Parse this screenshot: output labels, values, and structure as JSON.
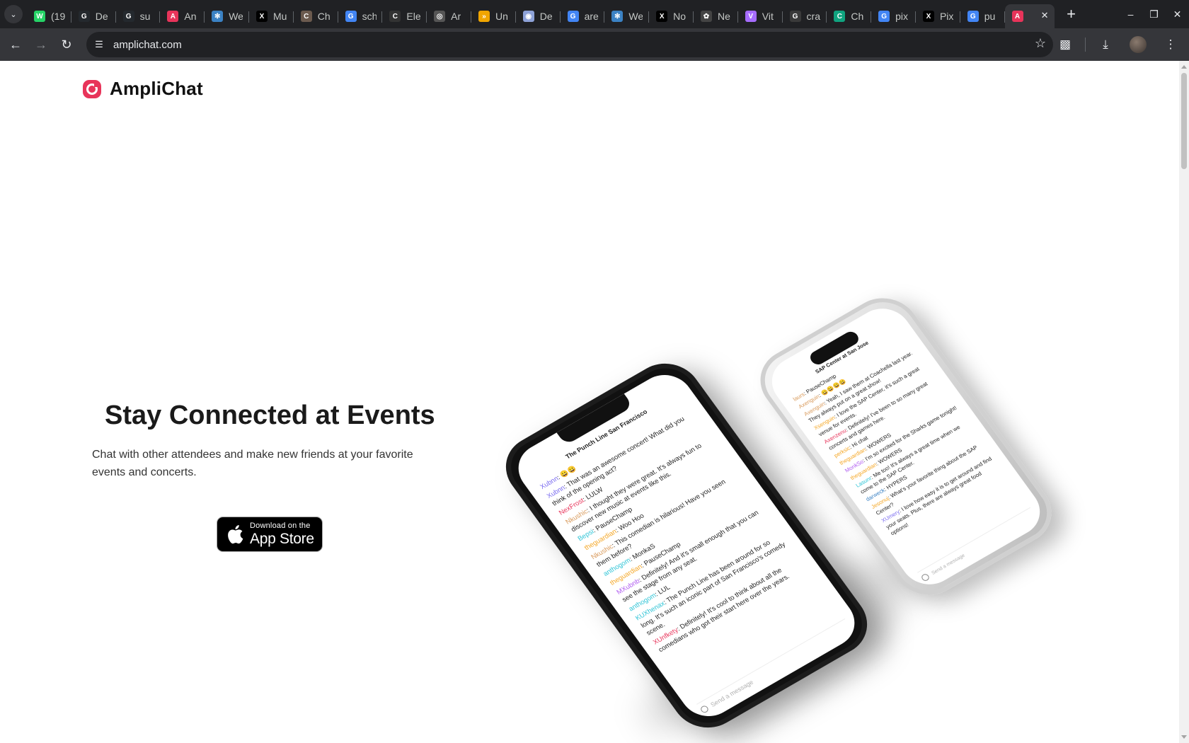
{
  "browser": {
    "tabs": [
      {
        "title": "(19",
        "icon": "whatsapp-icon",
        "color": "#25d366",
        "glyph": "W"
      },
      {
        "title": "De",
        "icon": "github-icon",
        "color": "#24292e",
        "glyph": "G"
      },
      {
        "title": "su",
        "icon": "github-icon",
        "color": "#24292e",
        "glyph": "G"
      },
      {
        "title": "An",
        "icon": "amplichat-icon",
        "color": "#e8345a",
        "glyph": "A"
      },
      {
        "title": "We",
        "icon": "react-icon",
        "color": "#3b82c4",
        "glyph": "✻"
      },
      {
        "title": "Mu",
        "icon": "x-icon",
        "color": "#000000",
        "glyph": "X"
      },
      {
        "title": "Ch",
        "icon": "profile-icon",
        "color": "#6b5a4e",
        "glyph": "C"
      },
      {
        "title": "sch",
        "icon": "google-icon",
        "color": "#4285f4",
        "glyph": "G"
      },
      {
        "title": "Ele",
        "icon": "codesandbox-icon",
        "color": "#333333",
        "glyph": "C"
      },
      {
        "title": "Ar",
        "icon": "globe-icon",
        "color": "#555555",
        "glyph": "◎"
      },
      {
        "title": "Un",
        "icon": "unsloth-icon",
        "color": "#f0a500",
        "glyph": "»"
      },
      {
        "title": "De",
        "icon": "deepseek-icon",
        "color": "#8ea2d8",
        "glyph": "◉"
      },
      {
        "title": "are",
        "icon": "google-icon",
        "color": "#4285f4",
        "glyph": "G"
      },
      {
        "title": "We",
        "icon": "react-icon",
        "color": "#3b82c4",
        "glyph": "✻"
      },
      {
        "title": "No",
        "icon": "x-icon",
        "color": "#000000",
        "glyph": "X"
      },
      {
        "title": "Ne",
        "icon": "openai-icon",
        "color": "#444444",
        "glyph": "✿"
      },
      {
        "title": "Vit",
        "icon": "vite-icon",
        "color": "#a66cff",
        "glyph": "V"
      },
      {
        "title": "cra",
        "icon": "github-icon",
        "color": "#3a3a3a",
        "glyph": "G"
      },
      {
        "title": "Ch",
        "icon": "chatgpt-icon",
        "color": "#10a37f",
        "glyph": "C"
      },
      {
        "title": "pix",
        "icon": "google-icon",
        "color": "#4285f4",
        "glyph": "G"
      },
      {
        "title": "Pix",
        "icon": "x-icon",
        "color": "#000000",
        "glyph": "X"
      },
      {
        "title": "pu",
        "icon": "google-icon",
        "color": "#4285f4",
        "glyph": "G"
      },
      {
        "title": "",
        "icon": "amplichat-icon",
        "color": "#e8345a",
        "glyph": "A",
        "active": true
      }
    ],
    "url": "amplichat.com"
  },
  "site": {
    "brand": "AmpliChat",
    "brand_color": "#e8345a",
    "hero_title": "Stay Connected at Events",
    "hero_subtitle": "Chat with other attendees and make new friends at your favorite events and concerts.",
    "appstore_small": "Download on the",
    "appstore_big": "App Store"
  },
  "phone_front": {
    "venue": "The Punch Line San Francisco",
    "messages": [
      {
        "user": "Xubnn",
        "color": "#7b6cf0",
        "text": "😀😀"
      },
      {
        "user": "Xubnn",
        "color": "#7b6cf0",
        "text": "That was an awesome concert! What did you think of the opening act?"
      },
      {
        "user": "NexFrost",
        "color": "#e8345a",
        "text": "LULW"
      },
      {
        "user": "Nkushic",
        "color": "#d99a5b",
        "text": "I thought they were great. It's always fun to discover new music at events like this."
      },
      {
        "user": "Bepsi",
        "color": "#2ec4d6",
        "text": "PauseChamp"
      },
      {
        "user": "theguardian",
        "color": "#f5a623",
        "text": "Woo Hoo"
      },
      {
        "user": "Nkushic",
        "color": "#d99a5b",
        "text": "This comedian is hilarious! Have you seen them before?"
      },
      {
        "user": "anthogom",
        "color": "#2ec4d6",
        "text": "MonkaS"
      },
      {
        "user": "theguardian",
        "color": "#f5a623",
        "text": "PauseChamp"
      },
      {
        "user": "MXubnb",
        "color": "#b05cf0",
        "text": "Definitely! And it's small enough that you can see the stage from any seat."
      },
      {
        "user": "anthogom",
        "color": "#2ec4d6",
        "text": "LUL"
      },
      {
        "user": "KUXhenax",
        "color": "#2ec4d6",
        "text": "The Punch Line has been around for so long. It's such an iconic part of San Francisco's comedy scene."
      },
      {
        "user": "XUnfkety",
        "color": "#e8345a",
        "text": "Definitely! It's cool to think about all the comedians who got their start here over the years."
      }
    ],
    "placeholder": "Send a message"
  },
  "phone_back": {
    "venue": "SAP Center at San Jose",
    "messages": [
      {
        "user": "laurs",
        "color": "#d99a5b",
        "text": "PauseChamp"
      },
      {
        "user": "Axenguin",
        "color": "#d99a5b",
        "text": "😀😀😀😀"
      },
      {
        "user": "Axenguin",
        "color": "#d99a5b",
        "text": "Yeah, I saw them at Coachella last year. They always put on a great show!"
      },
      {
        "user": "Xsenguin",
        "color": "#f5a623",
        "text": "I love the SAP Center, it's such a great venue for events."
      },
      {
        "user": "Axenzenu",
        "color": "#e8345a",
        "text": "Definitely! I've been to so many great concerts and games here."
      },
      {
        "user": "perksic",
        "color": "#f5a623",
        "text": "Hi chat"
      },
      {
        "user": "theguardian",
        "color": "#f5a623",
        "text": "WOWERS"
      },
      {
        "user": "MonkSo",
        "color": "#b05cf0",
        "text": "I'm so excited for the Sharks game tonight!"
      },
      {
        "user": "theguardian",
        "color": "#f5a623",
        "text": "WOWERS"
      },
      {
        "user": "Lasunr",
        "color": "#2ec4d6",
        "text": "Me too! It's always a great time when we come to the SAP Center."
      },
      {
        "user": "darweck",
        "color": "#3b82c4",
        "text": "HYPERS"
      },
      {
        "user": "Jesonuj",
        "color": "#f5a623",
        "text": "What's your favorite thing about the SAP Center?"
      },
      {
        "user": "XUmery",
        "color": "#7b6cf0",
        "text": "I love how easy it is to get around and find your seats. Plus, there are always great food options!"
      }
    ],
    "placeholder": "Send a message"
  }
}
